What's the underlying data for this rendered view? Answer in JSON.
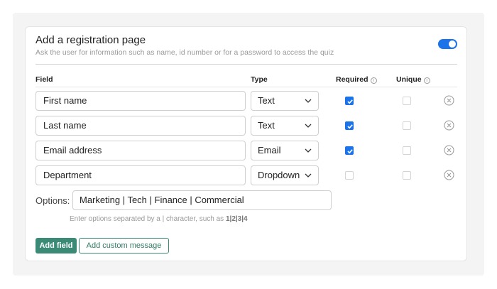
{
  "section": {
    "title": "Add a registration page",
    "subtitle": "Ask the user for information such as name, id number or for a password to access the quiz",
    "enabled": true
  },
  "columns": {
    "field": "Field",
    "type": "Type",
    "required": "Required",
    "unique": "Unique"
  },
  "rows": [
    {
      "field": "First name",
      "type": "Text",
      "required": true,
      "unique": false
    },
    {
      "field": "Last name",
      "type": "Text",
      "required": true,
      "unique": false
    },
    {
      "field": "Email address",
      "type": "Email",
      "required": true,
      "unique": false
    },
    {
      "field": "Department",
      "type": "Dropdown",
      "required": false,
      "unique": false
    }
  ],
  "options": {
    "label": "Options:",
    "value": "Marketing | Tech | Finance | Commercial",
    "hint_prefix": "Enter options separated by a | character, such as ",
    "hint_example": "1|2|3|4"
  },
  "buttons": {
    "add_field": "Add field",
    "add_custom_message": "Add custom message"
  },
  "colors": {
    "accent": "#1a73e8",
    "primary_button": "#3a8a75"
  }
}
